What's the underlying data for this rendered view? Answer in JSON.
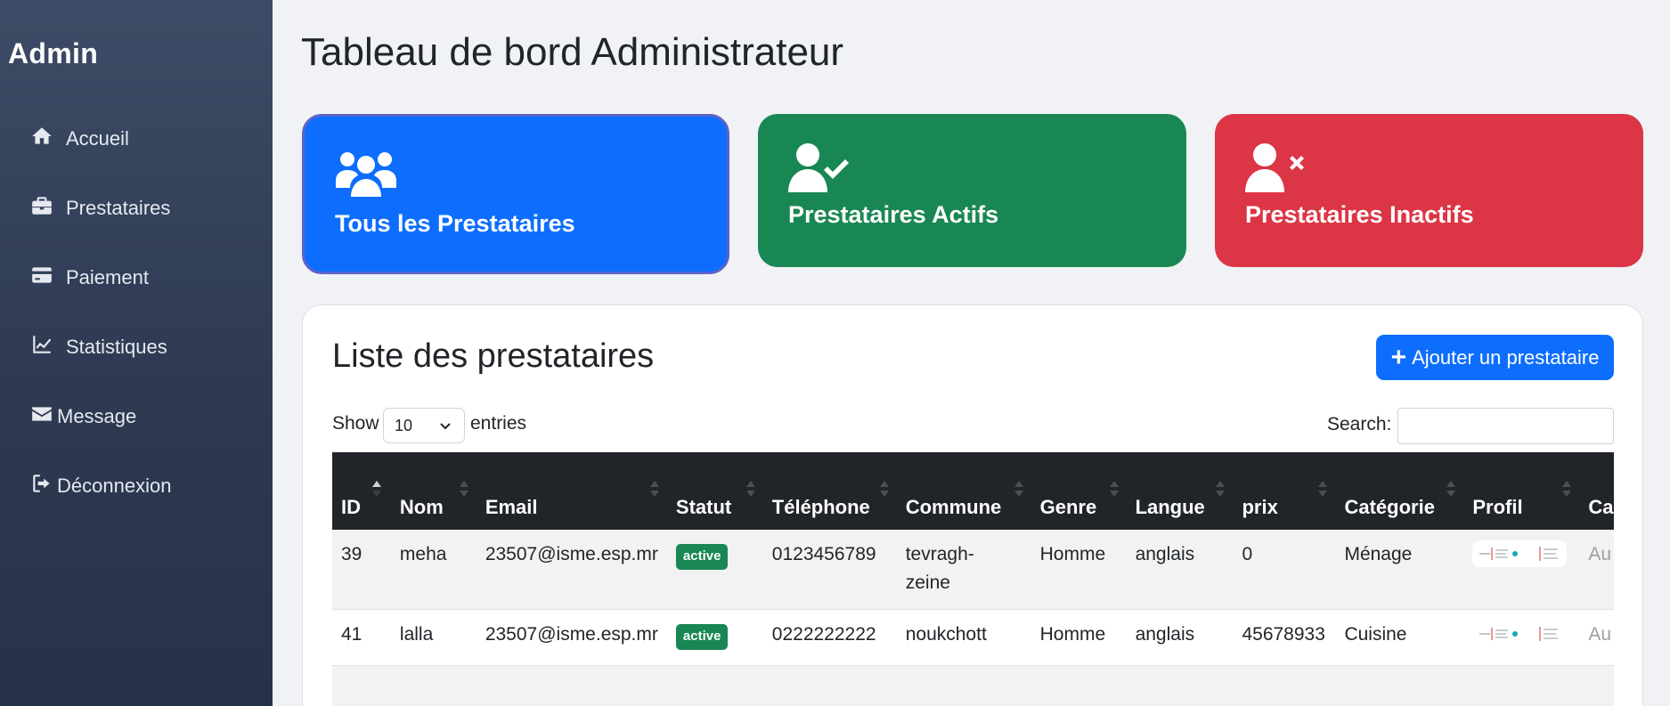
{
  "sidebar": {
    "brand": "Admin",
    "items": [
      {
        "label": "Accueil",
        "icon": "home-icon"
      },
      {
        "label": "Prestataires",
        "icon": "briefcase-icon"
      },
      {
        "label": "Paiement",
        "icon": "credit-card-icon"
      },
      {
        "label": "Statistiques",
        "icon": "line-chart-icon"
      },
      {
        "label": "Message",
        "icon": "envelope-icon"
      },
      {
        "label": "Déconnexion",
        "icon": "sign-out-icon"
      }
    ]
  },
  "page": {
    "title": "Tableau de bord Administrateur"
  },
  "cards": {
    "all": {
      "label": "Tous les Prestataires",
      "icon": "users-icon",
      "color": "#0d6efd"
    },
    "active": {
      "label": "Prestataires Actifs",
      "icon": "user-check-icon",
      "color": "#198754"
    },
    "inactive": {
      "label": "Prestataires Inactifs",
      "icon": "user-times-icon",
      "color": "#dc3545"
    }
  },
  "list": {
    "title": "Liste des prestataires",
    "add_button": "Ajouter un prestataire",
    "show_label": "Show",
    "entries_value": "10",
    "entries_label": "entries",
    "search_label": "Search:",
    "search_value": ""
  },
  "table": {
    "columns": [
      "ID",
      "Nom",
      "Email",
      "Statut",
      "Téléphone",
      "Commune",
      "Genre",
      "Langue",
      "prix",
      "Catégorie",
      "Profil",
      "Car d'i"
    ],
    "rows": [
      {
        "id": "39",
        "nom": "meha",
        "email": "23507@isme.esp.mr",
        "statut": "active",
        "telephone": "0123456789",
        "commune": "tevragh-zeine",
        "genre": "Homme",
        "langue": "anglais",
        "prix": "0",
        "categorie": "Ménage",
        "carte": "Au"
      },
      {
        "id": "41",
        "nom": "lalla",
        "email": "23507@isme.esp.mr",
        "statut": "active",
        "telephone": "0222222222",
        "commune": "noukchott",
        "genre": "Homme",
        "langue": "anglais",
        "prix": "45678933",
        "categorie": "Cuisine",
        "carte": "Au"
      }
    ]
  }
}
